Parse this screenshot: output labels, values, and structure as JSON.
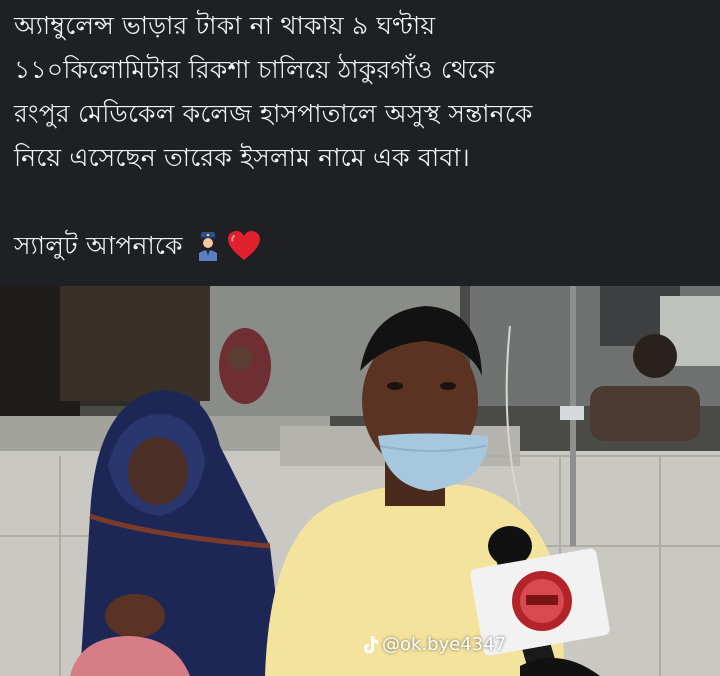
{
  "post": {
    "caption_lines": [
      "অ্যাম্বুলেন্স ভাড়ার টাকা না থাকায় ৯ ঘণ্টায়",
      "১১০কিলোমিটার রিকশা চালিয়ে ঠাকুরগাঁও থেকে",
      "রংপুর মেডিকেল কলেজ হাসপাতালে অসুস্থ সন্তানকে",
      "নিয়ে এসেছেন তারেক ইসলাম নামে এক বাবা।"
    ],
    "salute_text": "স্যালুট আপনাকে",
    "emojis": [
      "police-officer-icon",
      "red-heart-icon"
    ]
  },
  "watermark": {
    "handle": "@ok.bye4347",
    "icon": "tiktok-icon"
  },
  "colors": {
    "caption_bg": "#1f2024",
    "caption_text": "#f2f2f2",
    "heart": "#e0212e",
    "mic_logo": "#b3232a"
  }
}
